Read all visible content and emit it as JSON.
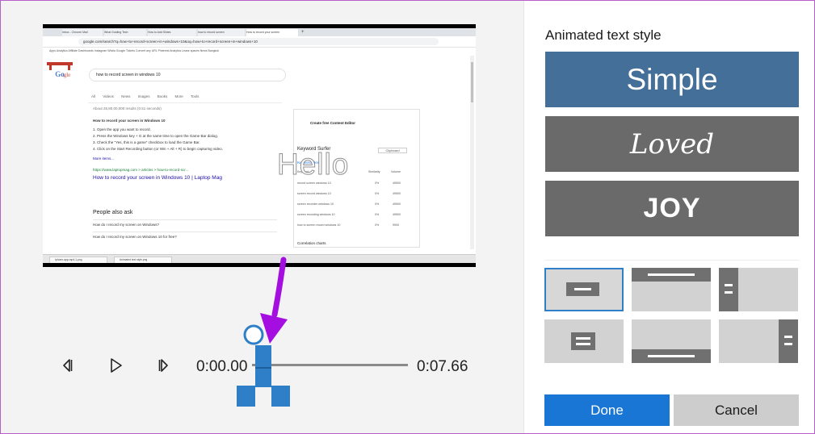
{
  "video": {
    "overlay_text": "Hello",
    "browser": {
      "tabs": [
        "Inbox - Chrome Mail",
        "What Guiding Tech",
        "How to Add Slides",
        "how to record screen",
        "How to record your screen",
        "+"
      ],
      "address": "google.com/search?q=how+to+record+screen+in+windows+10&oq=how+to+record+screen+in+windows+10",
      "bookmarks": "Apps  Analytics  Affiliate Dashboards  Instagram  Wistia  Google Tickets  Convert any URL  Pinterest Analytics  Lease spaces  News  Bangkok",
      "search_query": "how to record screen in windows 10",
      "search_tabs": "All  Videos  News  Images  Books  More  Tools",
      "result_count": "About 26,80,00,000 results (0.51 seconds)",
      "snippet_title": "How to record your screen in Windows 10",
      "snippet_steps": [
        "1. Open the app you want to record.",
        "2. Press the Windows key + G at the same time to open the Game Bar dialog.",
        "3. Check the \"Yes, this is a game\" checkbox to load the Game Bar.",
        "4. Click on the Start Recording button (or Win + Alt + R) to begin capturing video."
      ],
      "more_items": "More items...",
      "result_url": "https://www.laptopmag.com > articles > how-to-record-scr...",
      "result_title": "How to record your screen in Windows 10 | Laptop Mag",
      "people_also_ask": "People also ask",
      "paa_items": [
        "How do I record my screen on Windows?",
        "How do I record my screen on Windows 10 for free?"
      ],
      "keyword_surfer": "Keyword Surfer",
      "clipboard": "Clipboard",
      "keyword_ideas": "Keyword ideas",
      "keyword_headers": [
        "Keyword",
        "Similarity",
        "Volume"
      ],
      "keywords": [
        {
          "kw": "record screen windows 10",
          "sim": "0%",
          "vol": "49500"
        },
        {
          "kw": "screen record windows 10",
          "sim": "0%",
          "vol": "49500"
        },
        {
          "kw": "screen recorder windows 10",
          "sim": "0%",
          "vol": "49500"
        },
        {
          "kw": "screen recording windows 10",
          "sim": "0%",
          "vol": "49500"
        },
        {
          "kw": "how to screen record windows 10",
          "sim": "0%",
          "vol": "9900"
        }
      ],
      "create_content": "Create free Content Editor",
      "correlation": "Correlation charts",
      "taskbar": [
        "Iphone-app-mp4-1.png",
        "Animated text style.png"
      ]
    }
  },
  "playback": {
    "current_time": "0:00.00",
    "total_time": "0:07.66",
    "progress": 0.0
  },
  "panel": {
    "title": "Animated text style",
    "styles": [
      "Simple",
      "Loved",
      "JOY"
    ],
    "layouts": [
      "center",
      "top-banner",
      "left-bar",
      "center-small",
      "bottom-banner",
      "right-bar"
    ],
    "done_label": "Done",
    "cancel_label": "Cancel"
  },
  "colors": {
    "accent": "#1a76d4",
    "simple_card": "#436f98",
    "style_card": "#6a6a6a",
    "pointer": "#a50ee0"
  }
}
